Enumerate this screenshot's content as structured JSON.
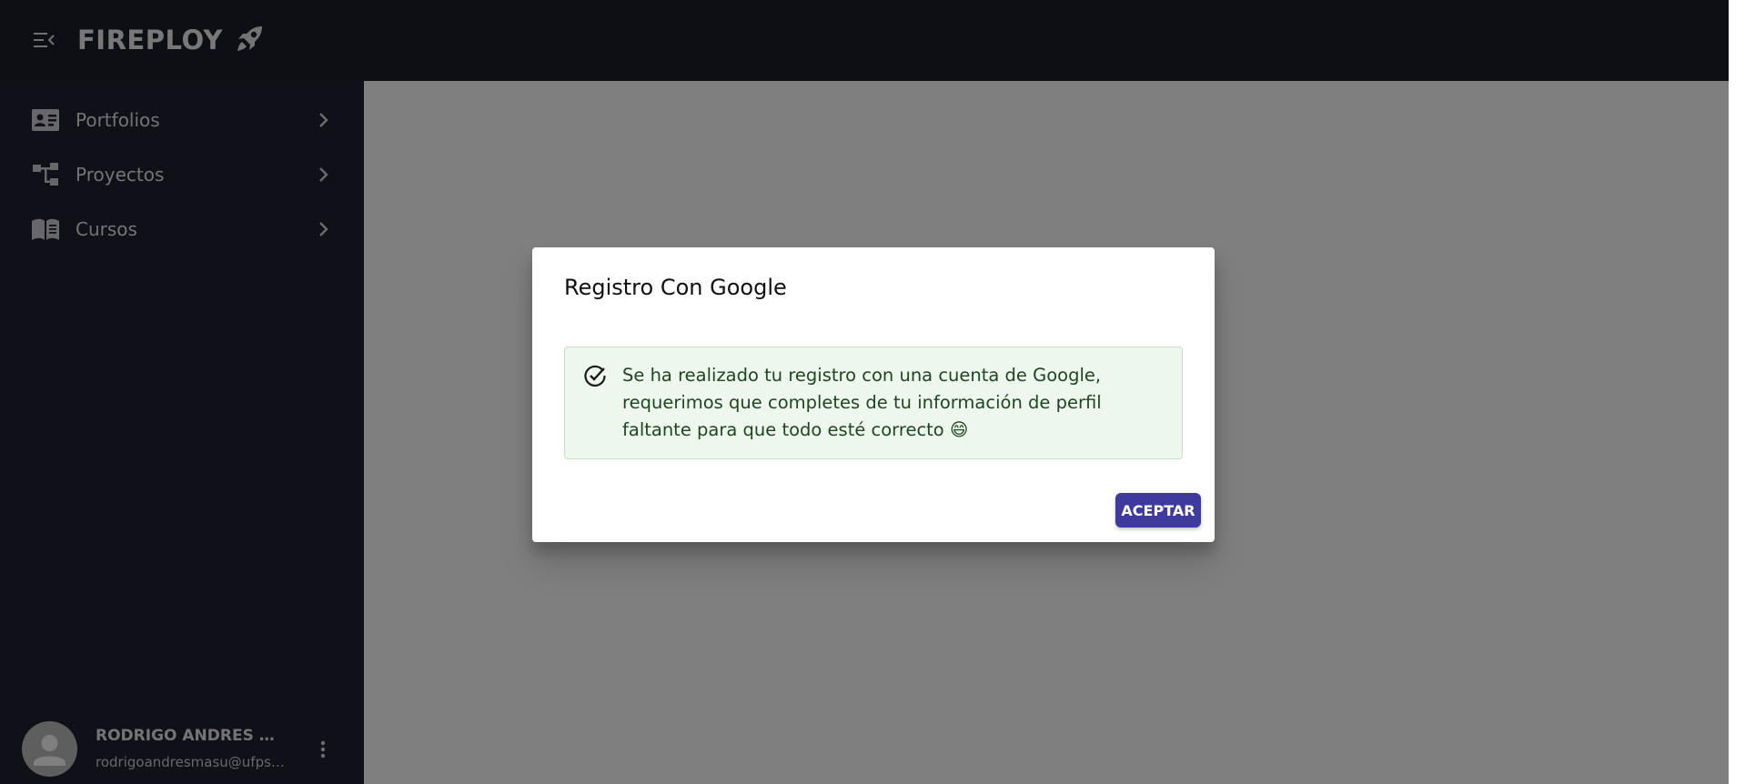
{
  "header": {
    "brand": "FIREPLOY",
    "menu_icon": "menu-open-icon",
    "brand_icon": "rocket-icon"
  },
  "sidebar": {
    "items": [
      {
        "label": "Portfolios",
        "icon": "contact-card-icon"
      },
      {
        "label": "Proyectos",
        "icon": "account-tree-icon"
      },
      {
        "label": "Cursos",
        "icon": "menu-book-icon"
      }
    ]
  },
  "user": {
    "name": "RODRIGO ANDRES MARTINEZ",
    "email": "rodrigoandresmasu@ufps.edu.co"
  },
  "dialog": {
    "title": "Registro Con Google",
    "message": "Se ha realizado tu registro con una cuenta de Google, requerimos que completes de tu información de perfil faltante para que todo esté correcto 😄",
    "accept_label": "ACEPTAR"
  },
  "colors": {
    "topbar": "#1d1e2b",
    "sidebar": "#1f2130",
    "alert_background": "#edf7ed",
    "alert_text": "#1e4620",
    "accept_button": "#3f3a9e"
  }
}
